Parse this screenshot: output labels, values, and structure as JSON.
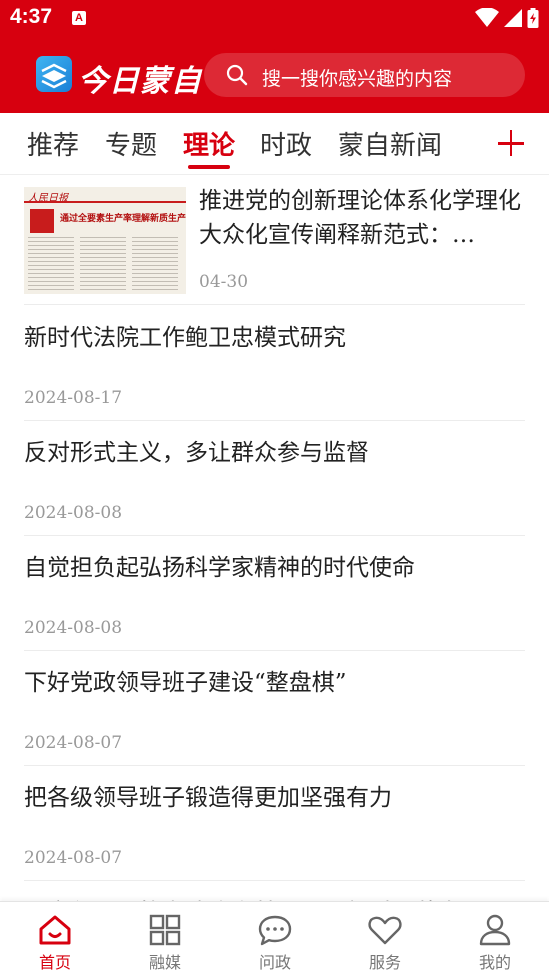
{
  "status_bar": {
    "time": "4:37",
    "notification_glyph": "A"
  },
  "header": {
    "logo_text": "今日蒙自",
    "search_placeholder": "搜一搜你感兴趣的内容"
  },
  "tabs": [
    {
      "label": "推荐",
      "active": false
    },
    {
      "label": "专题",
      "active": false
    },
    {
      "label": "理论",
      "active": true
    },
    {
      "label": "时政",
      "active": false
    },
    {
      "label": "蒙自新闻",
      "active": false
    }
  ],
  "feed": {
    "lead": {
      "title": "推进党的创新理论体系化学理化大众化宣传阐释新范式：…",
      "date": "04-30",
      "thumb_masthead": "人民日报",
      "thumb_headline": "通过全要素生产率理解新质生产力"
    },
    "items": [
      {
        "title": "新时代法院工作鲍卫忠模式研究",
        "date": "2024-08-17"
      },
      {
        "title": "反对形式主义，多让群众参与监督",
        "date": "2024-08-08"
      },
      {
        "title": "自觉担负起弘扬科学家精神的时代使命",
        "date": "2024-08-08"
      },
      {
        "title": "下好党政领导班子建设“整盘棋”",
        "date": "2024-08-07"
      },
      {
        "title": "把各级领导班子锻造得更加坚强有力",
        "date": "2024-08-07"
      },
      {
        "title": "以文化人，筑牢法治之基，加强新时代蒙自",
        "date": ""
      }
    ]
  },
  "bottom_nav": [
    {
      "label": "首页",
      "icon": "home-icon",
      "active": true
    },
    {
      "label": "融媒",
      "icon": "grid-icon",
      "active": false
    },
    {
      "label": "问政",
      "icon": "chat-icon",
      "active": false
    },
    {
      "label": "服务",
      "icon": "heart-icon",
      "active": false
    },
    {
      "label": "我的",
      "icon": "user-icon",
      "active": false
    }
  ],
  "colors": {
    "brand_red": "#d7000f",
    "text": "#222222",
    "muted": "#999999"
  }
}
